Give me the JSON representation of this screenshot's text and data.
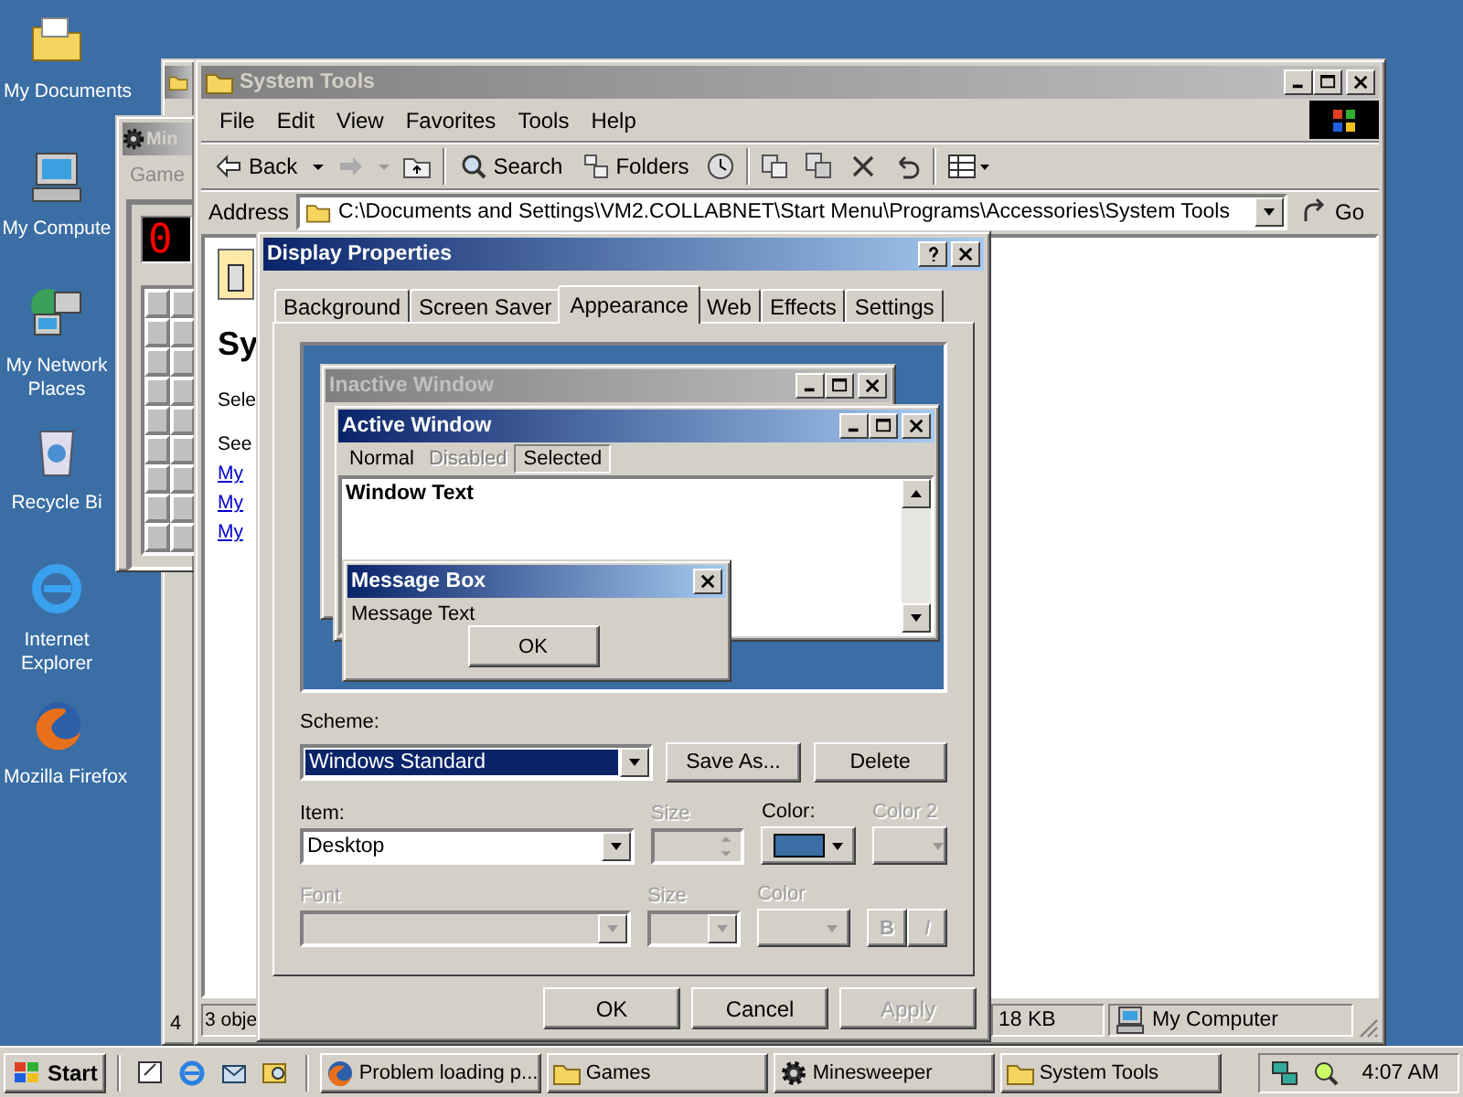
{
  "desktop_icons": [
    {
      "label": "My Documents",
      "kind": "documents"
    },
    {
      "label": "My Compute",
      "kind": "computer"
    },
    {
      "label": "My Network Places",
      "kind": "network"
    },
    {
      "label": "Recycle Bi",
      "kind": "recycle"
    },
    {
      "label": "Internet Explorer",
      "kind": "ie"
    },
    {
      "label": "Mozilla Firefox",
      "kind": "firefox"
    }
  ],
  "games_window": {
    "status": "4"
  },
  "minesweeper": {
    "title": "Min",
    "menu": [
      "Game"
    ],
    "counter": "0"
  },
  "explorer": {
    "title": "System Tools",
    "menu": [
      "File",
      "Edit",
      "View",
      "Favorites",
      "Tools",
      "Help"
    ],
    "back": "Back",
    "search": "Search",
    "folders": "Folders",
    "address_label": "Address",
    "address": "C:\\Documents and Settings\\VM2.COLLABNET\\Start Menu\\Programs\\Accessories\\System Tools",
    "go": "Go",
    "panel": {
      "heading": "Sy",
      "text_1": "Sele",
      "text_2": "See",
      "links": [
        "My",
        "My",
        "My"
      ]
    },
    "status": [
      "3 obje",
      "18 KB",
      "My Computer"
    ]
  },
  "dialog": {
    "title": "Display Properties",
    "tabs": [
      {
        "label": "Background",
        "selected": false
      },
      {
        "label": "Screen Saver",
        "selected": false
      },
      {
        "label": "Appearance",
        "selected": true
      },
      {
        "label": "Web",
        "selected": false
      },
      {
        "label": "Effects",
        "selected": false
      },
      {
        "label": "Settings",
        "selected": false
      }
    ],
    "preview": {
      "inactive_title": "Inactive Window",
      "active_title": "Active Window",
      "menu": [
        {
          "label": "Normal",
          "kind": "normal"
        },
        {
          "label": "Disabled",
          "kind": "disabled"
        },
        {
          "label": "Selected",
          "kind": "selected"
        }
      ],
      "window_text": "Window Text",
      "message_title": "Message Box",
      "message_text": "Message Text",
      "ok": "OK"
    },
    "scheme_label": "Scheme:",
    "scheme": "Windows Standard",
    "scheme_buttons": [
      "Save As...",
      "Delete"
    ],
    "fields": [
      {
        "label": "Item:",
        "value": "Desktop",
        "kind": "dropdown",
        "disabled": false
      },
      {
        "label": "Size",
        "kind": "spinner",
        "disabled": true
      },
      {
        "label": "Color:",
        "kind": "color",
        "color": "#3a6ea5",
        "disabled": false
      },
      {
        "label": "Color 2",
        "kind": "color",
        "disabled": true
      },
      {
        "label": "Font",
        "kind": "dropdown",
        "disabled": true
      },
      {
        "label": "Size",
        "kind": "dropdown",
        "disabled": true
      },
      {
        "label": "Color",
        "kind": "color",
        "disabled": true
      }
    ],
    "style_buttons": [
      {
        "label": "B",
        "disabled": true
      },
      {
        "label": "I",
        "disabled": true
      }
    ],
    "buttons": [
      {
        "label": "OK",
        "disabled": false
      },
      {
        "label": "Cancel",
        "disabled": false
      },
      {
        "label": "Apply",
        "disabled": true
      }
    ]
  },
  "taskbar": {
    "start": "Start",
    "tasks": [
      {
        "label": "Problem loading p...",
        "kind": "firefox",
        "selected": false
      },
      {
        "label": "Games",
        "kind": "folder",
        "selected": false
      },
      {
        "label": "Minesweeper",
        "kind": "gear",
        "selected": false
      },
      {
        "label": "System Tools",
        "kind": "folder",
        "selected": false
      }
    ],
    "clock": "4:07 AM"
  }
}
